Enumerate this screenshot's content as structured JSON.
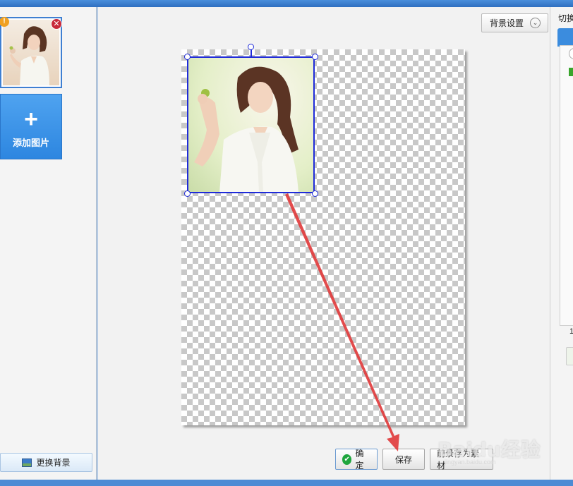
{
  "left_panel": {
    "add_image_label": "添加图片",
    "change_bg_label": "更换背景"
  },
  "toolbar": {
    "bg_settings_label": "背景设置"
  },
  "actions": {
    "confirm_label": "确定",
    "save_label": "保存",
    "save_foreground_label": "前景存为素材"
  },
  "right_panel": {
    "label": "切换",
    "number": "1"
  },
  "watermark": {
    "text": "Baidu经验",
    "sub": "jingyan.baidu.com"
  },
  "colors": {
    "accent": "#3e7fd2",
    "selection": "#1f2bd9",
    "arrow": "#e0383a",
    "confirm_check": "#1ea63e"
  }
}
